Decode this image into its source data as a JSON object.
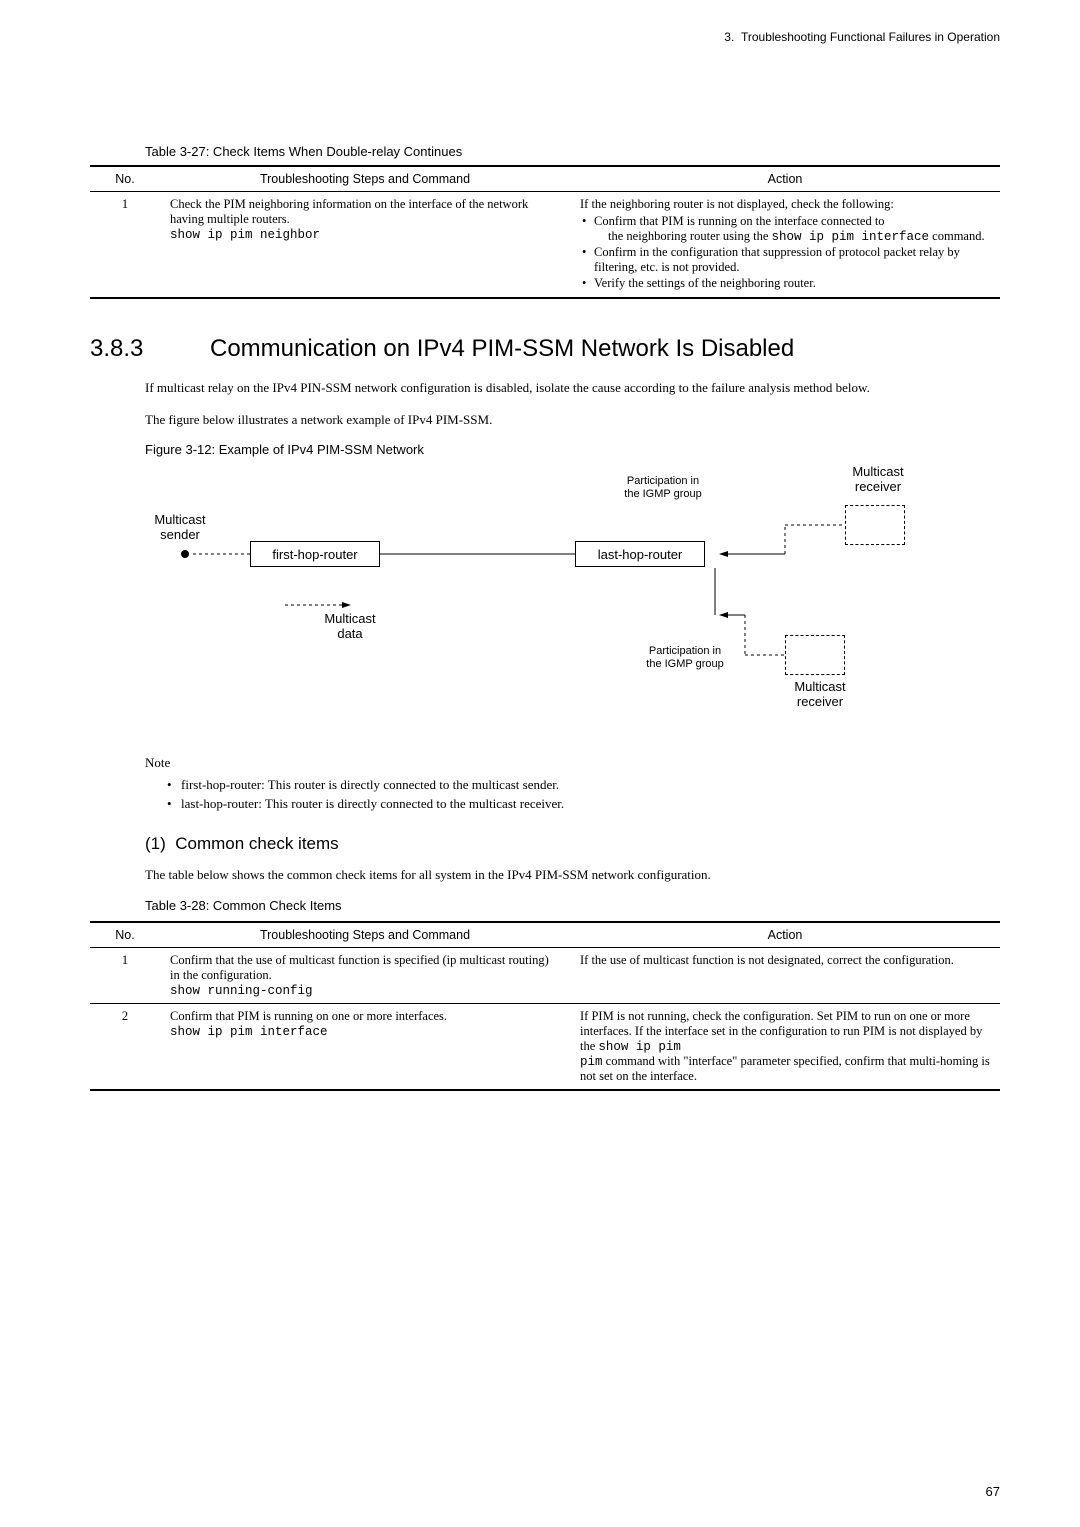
{
  "header": {
    "chapter": "3.",
    "title": "Troubleshooting Functional Failures in Operation"
  },
  "table327": {
    "caption": "Table 3-27: Check Items When Double-relay Continues",
    "headers": {
      "no": "No.",
      "steps": "Troubleshooting Steps and Command",
      "action": "Action"
    },
    "row": {
      "no": "1",
      "steps_line1": "Check the PIM neighboring information on the interface of the network having multiple routers.",
      "steps_cmd": "show ip pim neighbor",
      "action_intro": "If the neighboring router is not displayed, check the following:",
      "b1a": "Confirm that PIM is running on the interface connected to",
      "b1b_pre": "the neighboring router using the ",
      "b1b_cmd": "show ip pim interface",
      "b1b_post": " command.",
      "b2": "Confirm in the configuration that suppression of protocol packet relay by filtering, etc. is not provided.",
      "b3": "Verify the settings of the neighboring router."
    }
  },
  "section": {
    "num": "3.8.3",
    "title": "Communication on IPv4 PIM-SSM Network Is Disabled",
    "p1": "If multicast relay on the IPv4 PIN-SSM network configuration is disabled, isolate the cause according to the failure analysis method below.",
    "p2": "The figure below illustrates a network example of IPv4 PIM-SSM."
  },
  "figure": {
    "caption": "Figure 3-12: Example of IPv4 PIM-SSM Network",
    "labels": {
      "mc_sender": "Multicast\nsender",
      "first_hop": "first-hop-router",
      "last_hop": "last-hop-router",
      "mc_data": "Multicast\ndata",
      "part_igmp": "Participation in\nthe IGMP group",
      "mc_receiver": "Multicast\nreceiver"
    }
  },
  "note": {
    "head": "Note",
    "n1": "first-hop-router: This router is directly connected to the multicast sender.",
    "n2": "last-hop-router: This router is directly connected to the multicast receiver."
  },
  "sub": {
    "num": "(1)",
    "title": "Common check items",
    "p": "The table below shows the common check items for all system in the IPv4 PIM-SSM network configuration."
  },
  "table328": {
    "caption": "Table 3-28: Common Check Items",
    "headers": {
      "no": "No.",
      "steps": "Troubleshooting Steps and Command",
      "action": "Action"
    },
    "row1": {
      "no": "1",
      "steps_a": "Confirm that the use of multicast function is specified (ip multicast routing) in the configuration.",
      "steps_cmd": "show running-config",
      "action": "If the use of multicast function is not designated, correct the configuration."
    },
    "row2": {
      "no": "2",
      "steps_a": "Confirm that PIM is running on one or more interfaces.",
      "steps_cmd": "show ip pim interface",
      "a1": "If PIM is not running, check the configuration. Set PIM to run on one or more interfaces. If the interface set in the",
      "a2_pre": "configuration to run PIM is not displayed by the ",
      "a2_cmd1": "show ip pim",
      "a2_cmd2": "pim",
      "a3": " command with \"interface\" parameter specified, confirm that multi-homing is not set on the interface."
    }
  },
  "pagenum": "67"
}
